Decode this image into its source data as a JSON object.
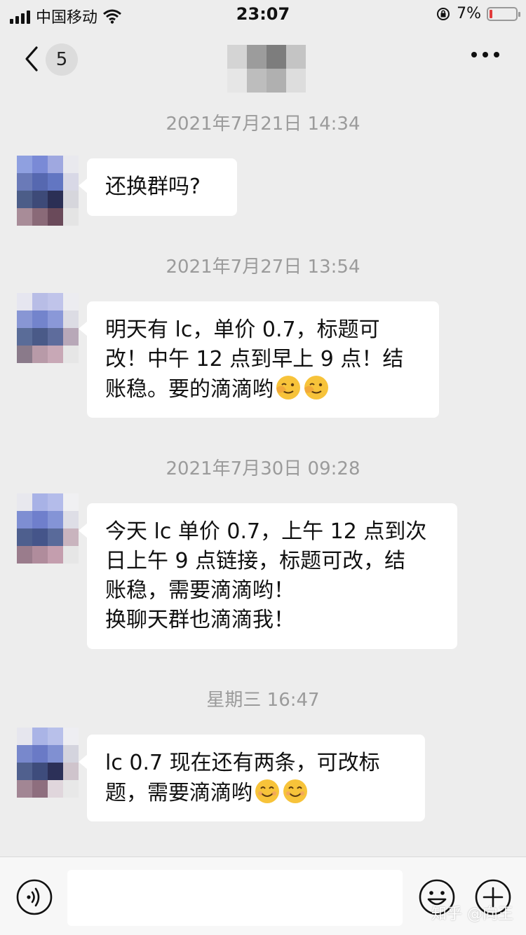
{
  "status_bar": {
    "carrier": "中国移动",
    "time": "23:07",
    "battery": "7%"
  },
  "nav": {
    "unread_count": "5"
  },
  "messages": [
    {
      "timestamp": "2021年7月21日 14:34",
      "text": "还换群吗?"
    },
    {
      "timestamp": "2021年7月27日 13:54",
      "text": "明天有 lc，单价 0.7，标题可\n改！中午 12 点到早上 9 点！结\n账稳。要的滴滴哟"
    },
    {
      "timestamp": "2021年7月30日 09:28",
      "text": "今天 lc 单价 0.7，上午 12 点到次\n日上午 9 点链接，标题可改，结\n账稳，需要滴滴哟！\n换聊天群也滴滴我！"
    },
    {
      "timestamp": "星期三 16:47",
      "text": "lc 0.7 现在还有两条，可改标\n题，需要滴滴哟"
    }
  ],
  "input": {
    "value": ""
  },
  "watermark": "知乎 @向王",
  "colors": {
    "background": "#ededed",
    "bubble": "#ffffff",
    "timestamp": "#9b9b9b",
    "battery_low": "#e23b3b"
  },
  "icons": [
    "signal-icon",
    "wifi-icon",
    "rotation-lock-icon",
    "battery-icon",
    "back-chevron-icon",
    "more-icon",
    "voice-icon",
    "emoji-icon",
    "plus-icon",
    "wink-emoji-icon",
    "smile-emoji-icon"
  ]
}
